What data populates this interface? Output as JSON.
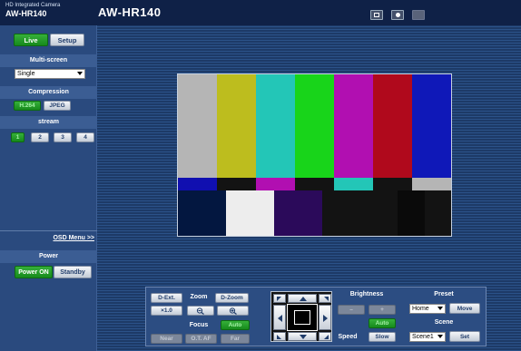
{
  "header": {
    "brand_sub": "HD Integrated Camera",
    "brand_model": "AW-HR140",
    "title": "AW-HR140",
    "icons": [
      "grid-icon",
      "snapshot-icon",
      "disabled-icon"
    ]
  },
  "sidebar": {
    "live_label": "Live",
    "setup_label": "Setup",
    "multi_screen_label": "Multi-screen",
    "multi_screen_value": "Single",
    "compression_label": "Compression",
    "compression_buttons": [
      "H.264",
      "JPEG"
    ],
    "stream_label": "stream",
    "stream_buttons": [
      "1",
      "2",
      "3",
      "4"
    ],
    "osd_menu_label": "OSD Menu >>",
    "power_label": "Power",
    "power_on_label": "Power ON",
    "standby_label": "Standby"
  },
  "video": {
    "top_colors": [
      "#b5b5b5",
      "#bdbd1e",
      "#23c6b7",
      "#18d41a",
      "#b10fb1",
      "#b0091c",
      "#0f18b8"
    ],
    "mid_colors": [
      "#100fb0",
      "#131313",
      "#b10fb1",
      "#131313",
      "#23c6b7",
      "#131313",
      "#b5b5b5"
    ],
    "bottom_colors": [
      "#031740",
      "#ededed",
      "#2b0a5a",
      "#131313",
      "#131313",
      "#0a0a0a",
      "#131313"
    ]
  },
  "controls": {
    "d_ext": "D-Ext.",
    "zoom_label": "Zoom",
    "d_zoom": "D-Zoom",
    "zoom_value": "×1.0",
    "focus_label": "Focus",
    "auto_label": "Auto",
    "near": "Near",
    "ot_af": "O.T. AF",
    "far": "Far",
    "brightness_label": "Brightness",
    "bright_minus": "–",
    "bright_plus": "+",
    "bright_auto": "Auto",
    "speed_label": "Speed",
    "speed_value": "Slow",
    "preset_label": "Preset",
    "preset_value": "Home",
    "move_label": "Move",
    "scene_label": "Scene",
    "scene_value": "Scene1",
    "set_label": "Set"
  }
}
